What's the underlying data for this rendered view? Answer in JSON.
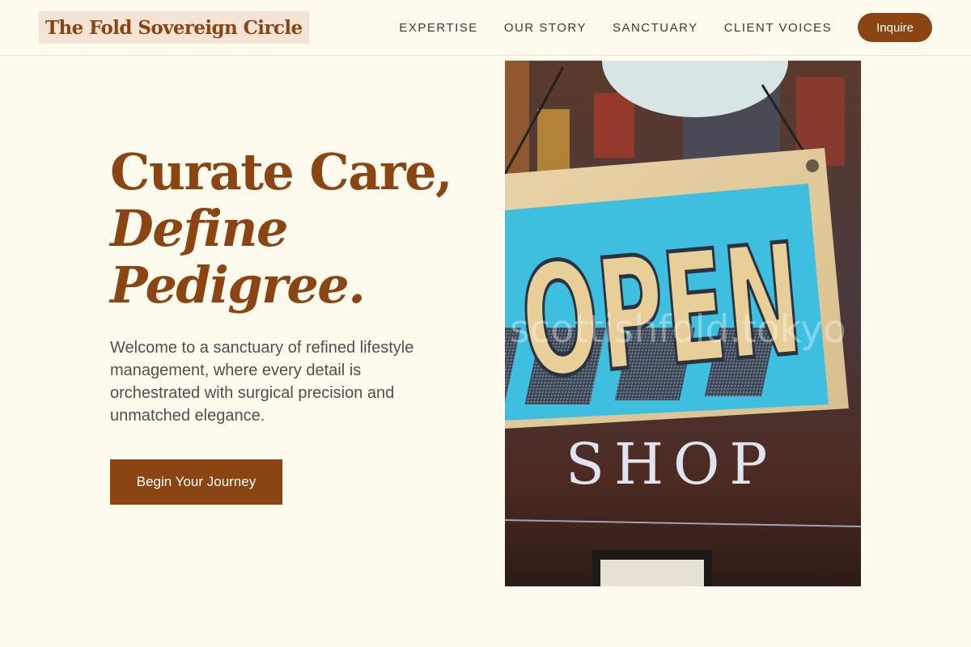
{
  "header": {
    "brand": "The Fold Sovereign Circle",
    "nav": [
      {
        "label": "EXPERTISE"
      },
      {
        "label": "OUR STORY"
      },
      {
        "label": "SANCTUARY"
      },
      {
        "label": "CLIENT VOICES"
      }
    ],
    "inquire_label": "Inquire"
  },
  "hero": {
    "title_line1": "Curate Care,",
    "title_line2": "Define",
    "title_line3": "Pedigree.",
    "description": "Welcome to a sanctuary of refined lifestyle management, where every detail is orchestrated with surgical precision and unmatched elegance.",
    "cta_label": "Begin Your Journey"
  },
  "image": {
    "sign_text": "OPEN",
    "door_text": "SHOP",
    "watermark": "scottishfold.tokyo"
  },
  "colors": {
    "accent": "#8b4513",
    "background": "#fefaed",
    "brand_highlight": "#f3e4d6"
  }
}
